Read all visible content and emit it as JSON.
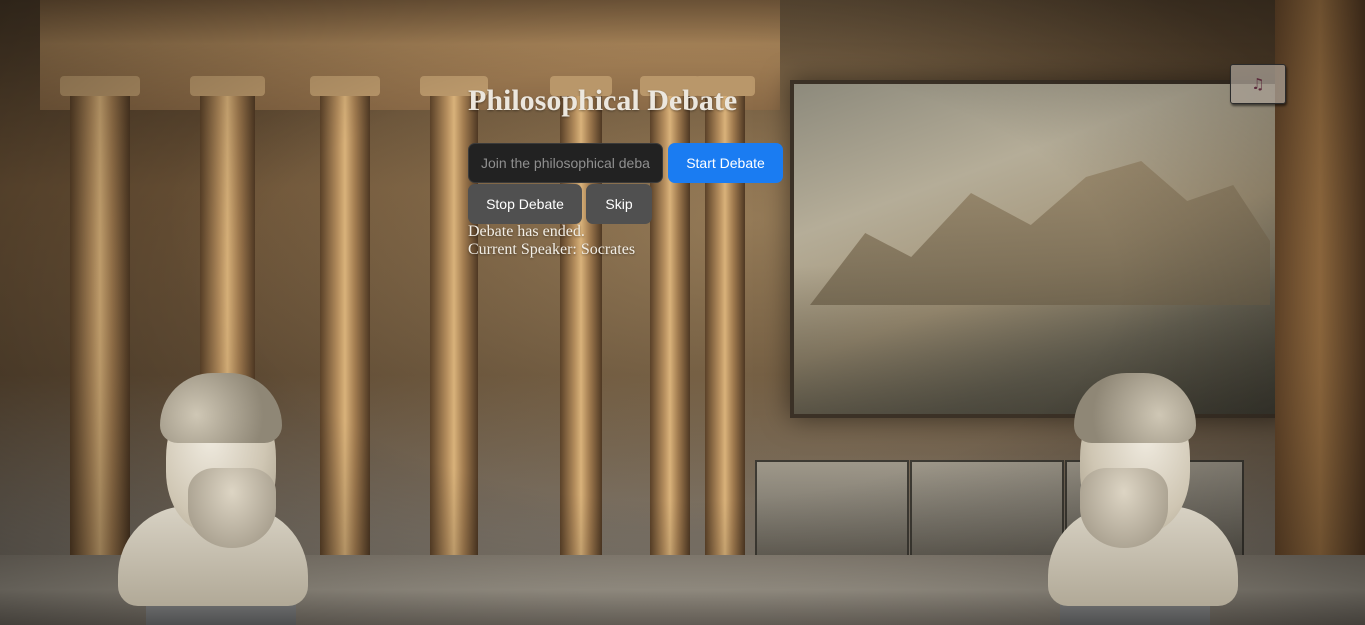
{
  "page": {
    "title": "Philosophical Debate"
  },
  "controls": {
    "topic_input": {
      "placeholder": "Join the philosophical debate",
      "value": ""
    },
    "start_label": "Start Debate",
    "stop_label": "Stop Debate",
    "skip_label": "Skip"
  },
  "status": {
    "debate_status": "Debate has ended.",
    "current_speaker": "Current Speaker: Socrates"
  },
  "music": {
    "icon": "music-note-icon",
    "glyph": "♫"
  },
  "colors": {
    "accent": "#1a7cf2",
    "secondary_button": "#505050",
    "input_background": "#222222",
    "title_text": "#ece7de"
  }
}
